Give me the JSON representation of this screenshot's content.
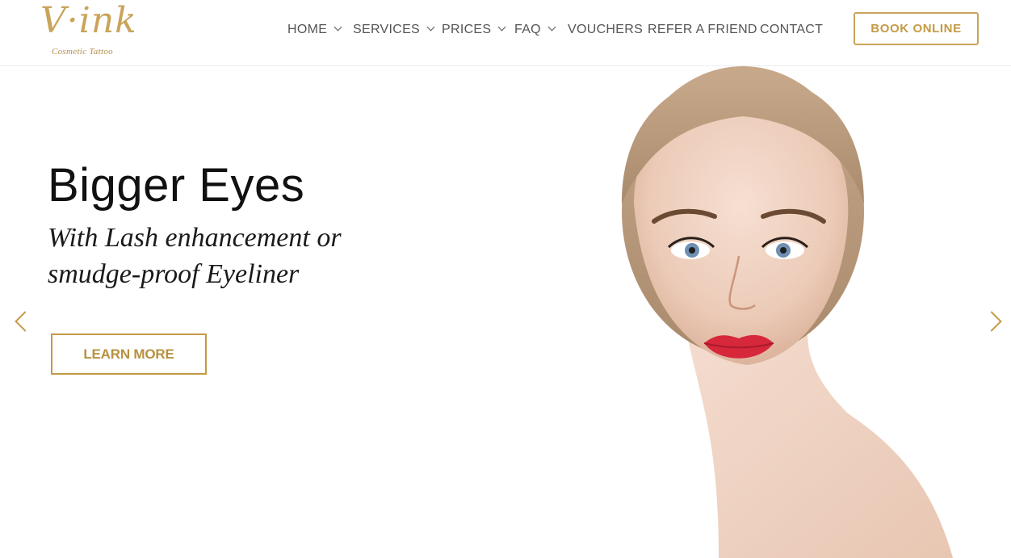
{
  "brand": {
    "logo_text": "V·ink",
    "logo_tagline": "Cosmetic Tattoo",
    "accent_color": "#c49a45"
  },
  "nav": {
    "items": [
      {
        "label": "HOME",
        "has_dropdown": true
      },
      {
        "label": "SERVICES",
        "has_dropdown": true
      },
      {
        "label": "PRICES",
        "has_dropdown": true
      },
      {
        "label": "FAQ",
        "has_dropdown": true
      },
      {
        "label": "VOUCHERS",
        "has_dropdown": false
      },
      {
        "label": "REFER A FRIEND",
        "has_dropdown": false
      },
      {
        "label": "CONTACT",
        "has_dropdown": false
      }
    ],
    "book_label": "BOOK ONLINE"
  },
  "hero": {
    "title": "Bigger Eyes",
    "subtitle": "With Lash enhancement or smudge-proof Eyeliner",
    "cta_label": "LEARN MORE",
    "prev_icon": "chevron-left-icon",
    "next_icon": "chevron-right-icon"
  }
}
